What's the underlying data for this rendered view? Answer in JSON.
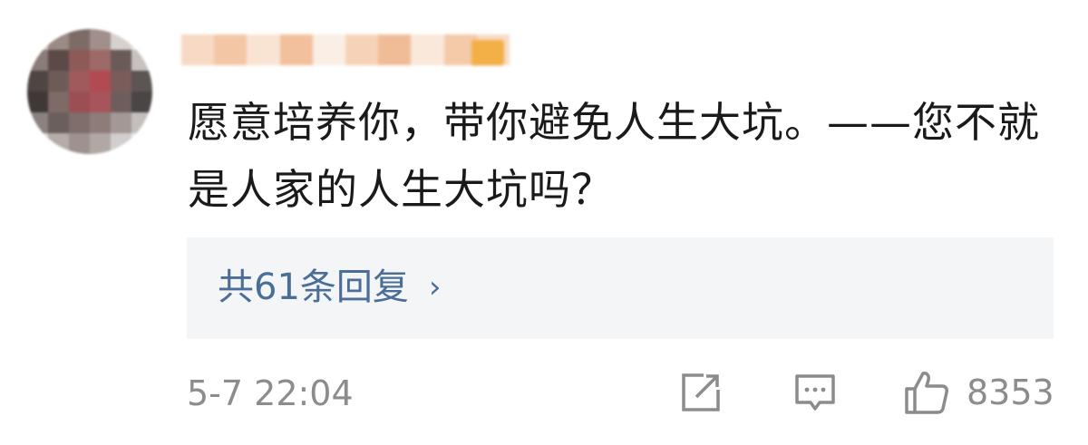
{
  "comment": {
    "text": "愿意培养你，带你避免人生大坑。——您不就是人家的人生大坑吗？",
    "timestamp": "5-7 22:04"
  },
  "replies": {
    "label": "共61条回复",
    "chevron": "›"
  },
  "actions": {
    "repost_icon": "repost-icon",
    "comment_icon": "comment-icon",
    "like_icon": "thumbs-up-icon",
    "like_count": "8353"
  },
  "colors": {
    "link": "#4a6e98",
    "muted": "#8c8c8c",
    "text": "#1a1a1a",
    "replies_bg": "#f4f5f7"
  }
}
